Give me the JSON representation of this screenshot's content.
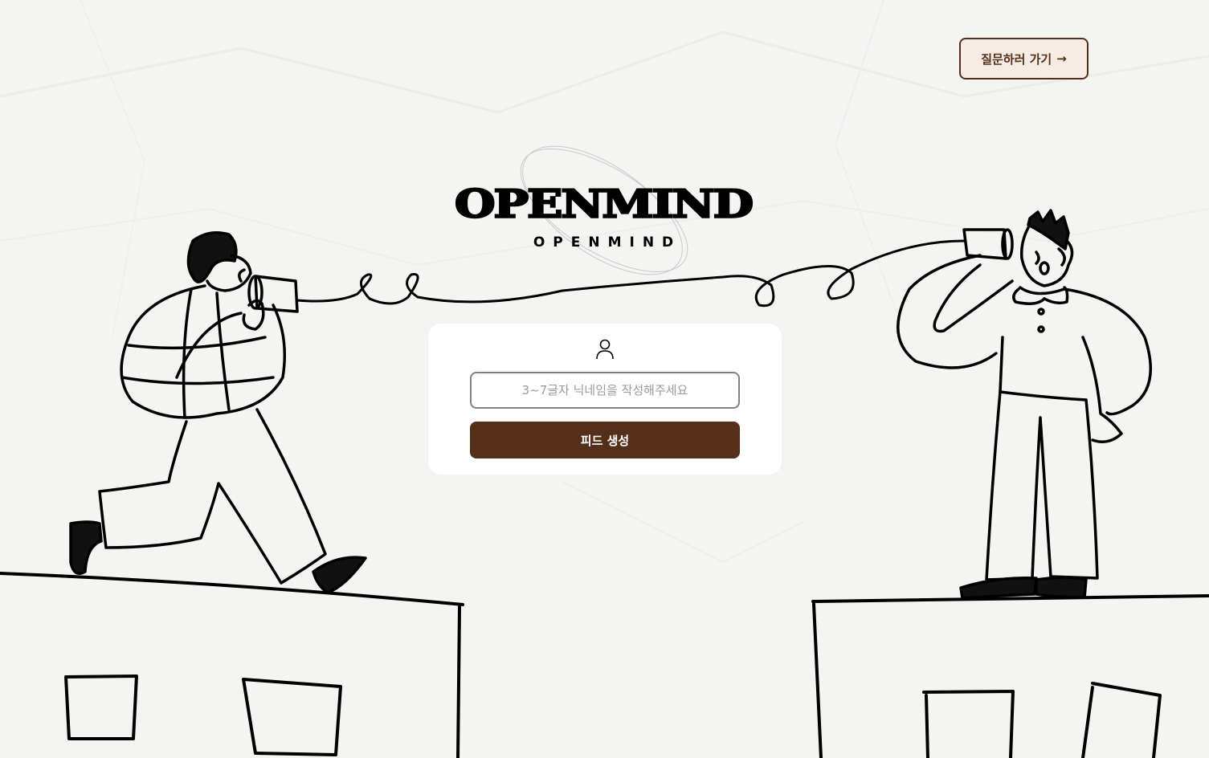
{
  "brand": {
    "logo_text": "OPENMIND",
    "logo_subtext": "OPENMIND"
  },
  "header": {
    "go_question_label": "질문하러 가기",
    "go_question_arrow": "→"
  },
  "feed_form": {
    "nickname_placeholder": "3~7글자 닉네임을 작성해주세요",
    "nickname_value": "",
    "submit_label": "피드 생성"
  },
  "icons": {
    "user": "user-icon",
    "arrow": "arrow-right-icon"
  },
  "colors": {
    "brand_brown": "#542f1a",
    "button_bg_light": "#f6ece3",
    "background": "#f4f4f3",
    "card": "#ffffff",
    "input_border": "#818181"
  }
}
